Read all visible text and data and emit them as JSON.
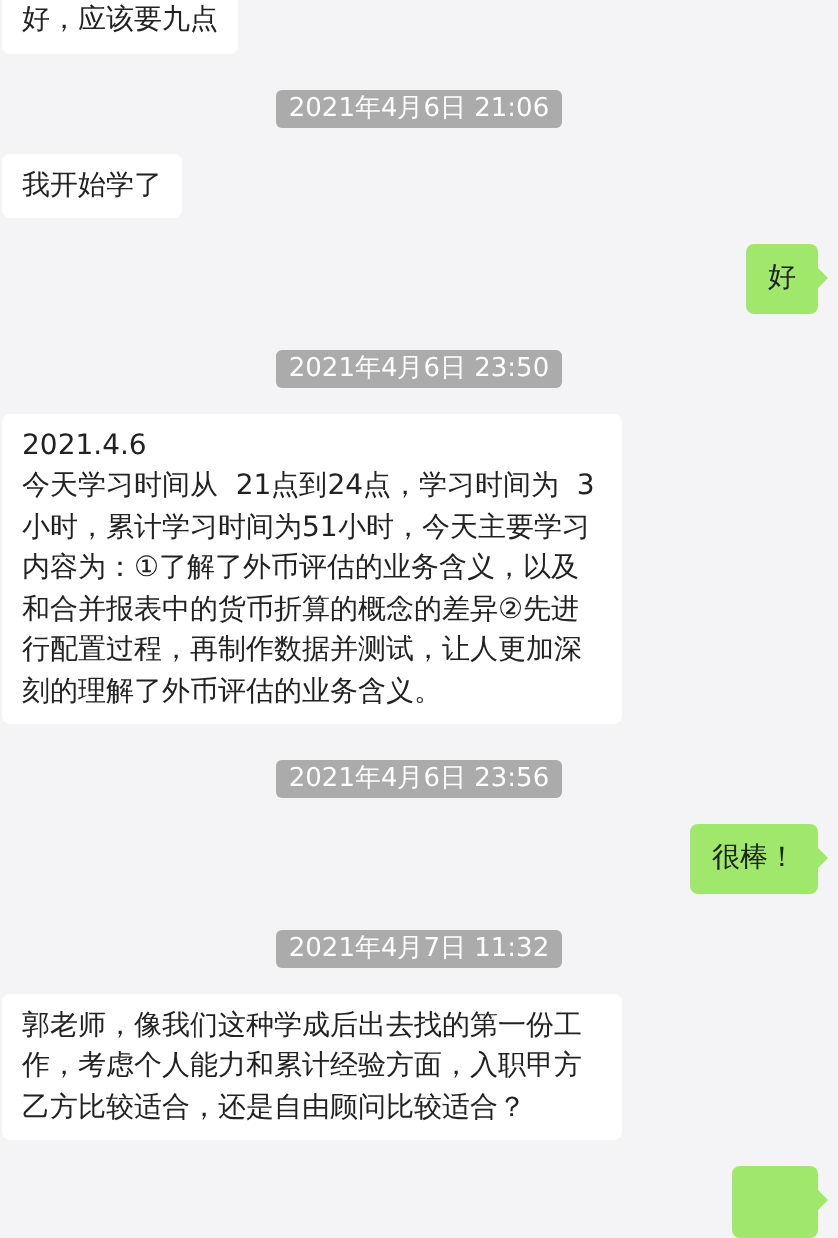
{
  "messages": [
    {
      "kind": "received",
      "text": "好，应该要九点"
    },
    {
      "kind": "timestamp",
      "text": "2021年4月6日 21:06"
    },
    {
      "kind": "received",
      "text": "我开始学了"
    },
    {
      "kind": "sent",
      "text": "好"
    },
    {
      "kind": "timestamp",
      "text": "2021年4月6日 23:50"
    },
    {
      "kind": "received",
      "text": "2021.4.6\n今天学习时间从  21点到24点，学习时间为  3小时，累计学习时间为51小时，今天主要学习内容为：①了解了外币评估的业务含义，以及和合并报表中的货币折算的概念的差异②先进行配置过程，再制作数据并测试，让人更加深刻的理解了外币评估的业务含义。"
    },
    {
      "kind": "timestamp",
      "text": "2021年4月6日 23:56"
    },
    {
      "kind": "sent",
      "text": "很棒！"
    },
    {
      "kind": "timestamp",
      "text": "2021年4月7日 11:32"
    },
    {
      "kind": "received",
      "text": "郭老师，像我们这种学成后出去找的第一份工作，考虑个人能力和累计经验方面，入职甲方乙方比较适合，还是自由顾问比较适合？"
    },
    {
      "kind": "sent"
    }
  ]
}
